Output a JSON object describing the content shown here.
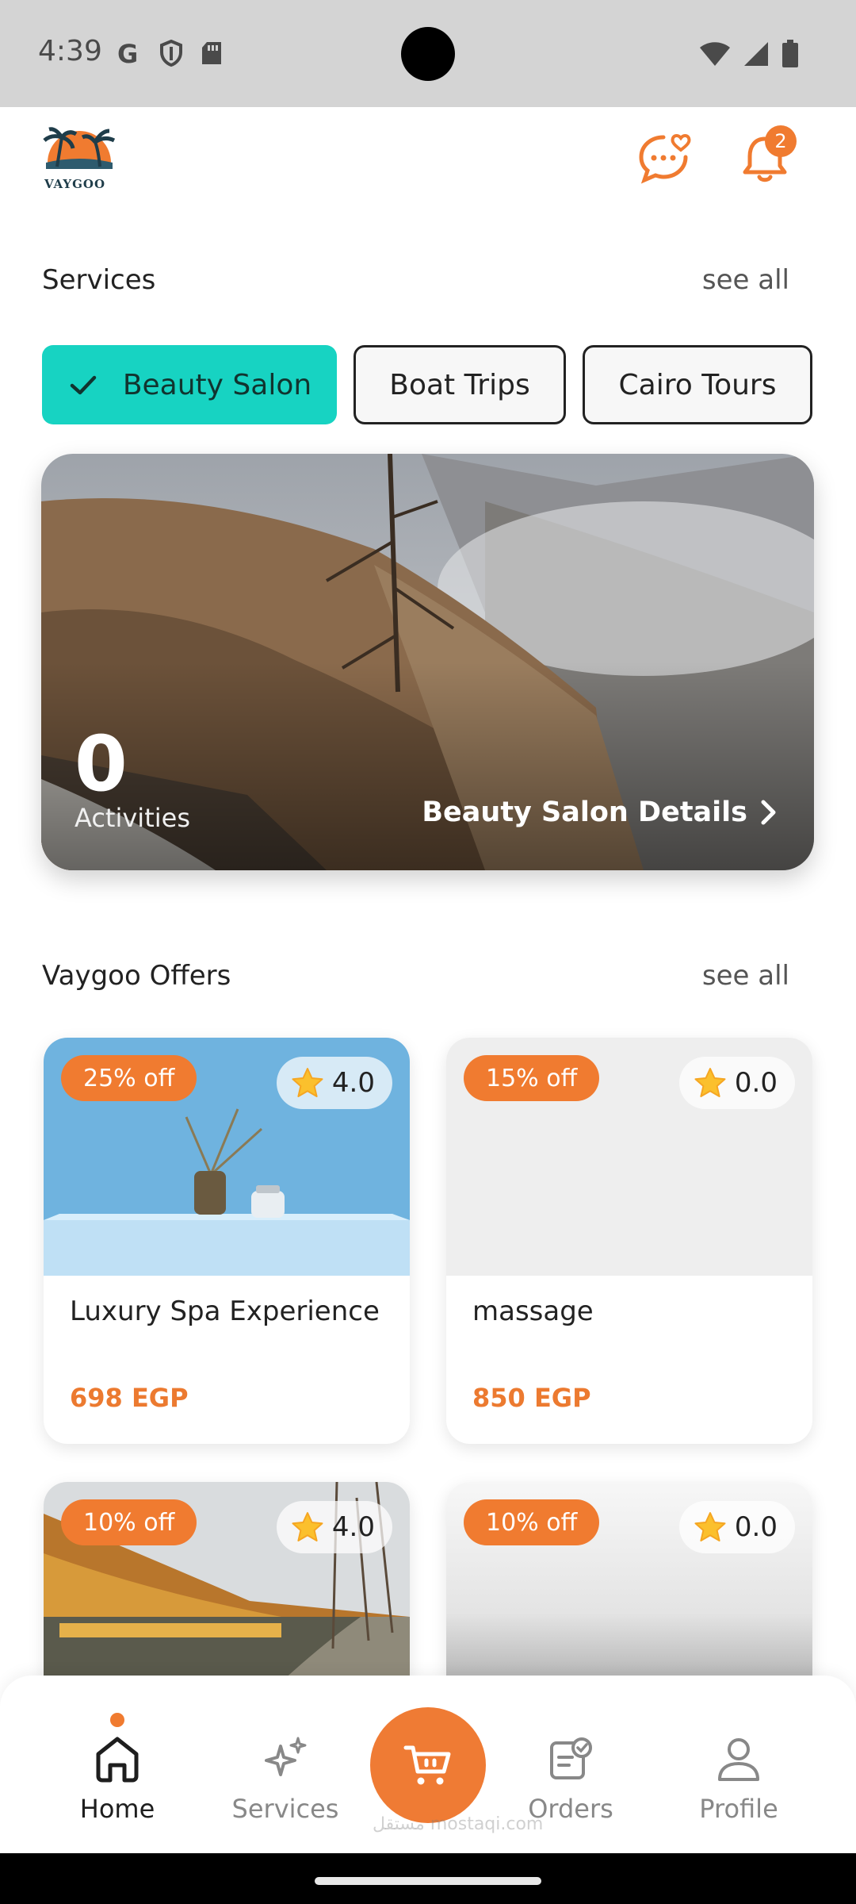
{
  "status_bar": {
    "time": "4:39",
    "left_icons": [
      "google-icon",
      "shield-icon",
      "sd-card-icon"
    ],
    "right_icons": [
      "wifi-icon",
      "signal-icon",
      "battery-icon"
    ]
  },
  "header": {
    "logo_text": "VAYGOO",
    "notification_count": "2"
  },
  "services": {
    "title": "Services",
    "see_all": "see all",
    "chips": [
      {
        "label": "Beauty Salon",
        "selected": true
      },
      {
        "label": "Boat Trips",
        "selected": false
      },
      {
        "label": "Cairo Tours",
        "selected": false
      }
    ]
  },
  "hero": {
    "count": "0",
    "count_label": "Activities",
    "details_link": "Beauty Salon Details"
  },
  "offers": {
    "title": "Vaygoo Offers",
    "see_all": "see all",
    "items": [
      {
        "discount": "25% off",
        "rating": "4.0",
        "name": "Luxury Spa Experience",
        "price": "698 EGP"
      },
      {
        "discount": "15% off",
        "rating": "0.0",
        "name": "massage",
        "price": "850 EGP"
      },
      {
        "discount": "10% off",
        "rating": "4.0"
      },
      {
        "discount": "10% off",
        "rating": "0.0"
      }
    ]
  },
  "bottom_nav": {
    "items": [
      {
        "label": "Home",
        "active": true
      },
      {
        "label": "Services",
        "active": false
      },
      {
        "label": "Orders",
        "active": false
      },
      {
        "label": "Profile",
        "active": false
      }
    ],
    "watermark": "مستقل mostaqi.com"
  },
  "colors": {
    "accent": "#f07b30",
    "chip_active": "#17d3c2",
    "price": "#ec7a30"
  }
}
